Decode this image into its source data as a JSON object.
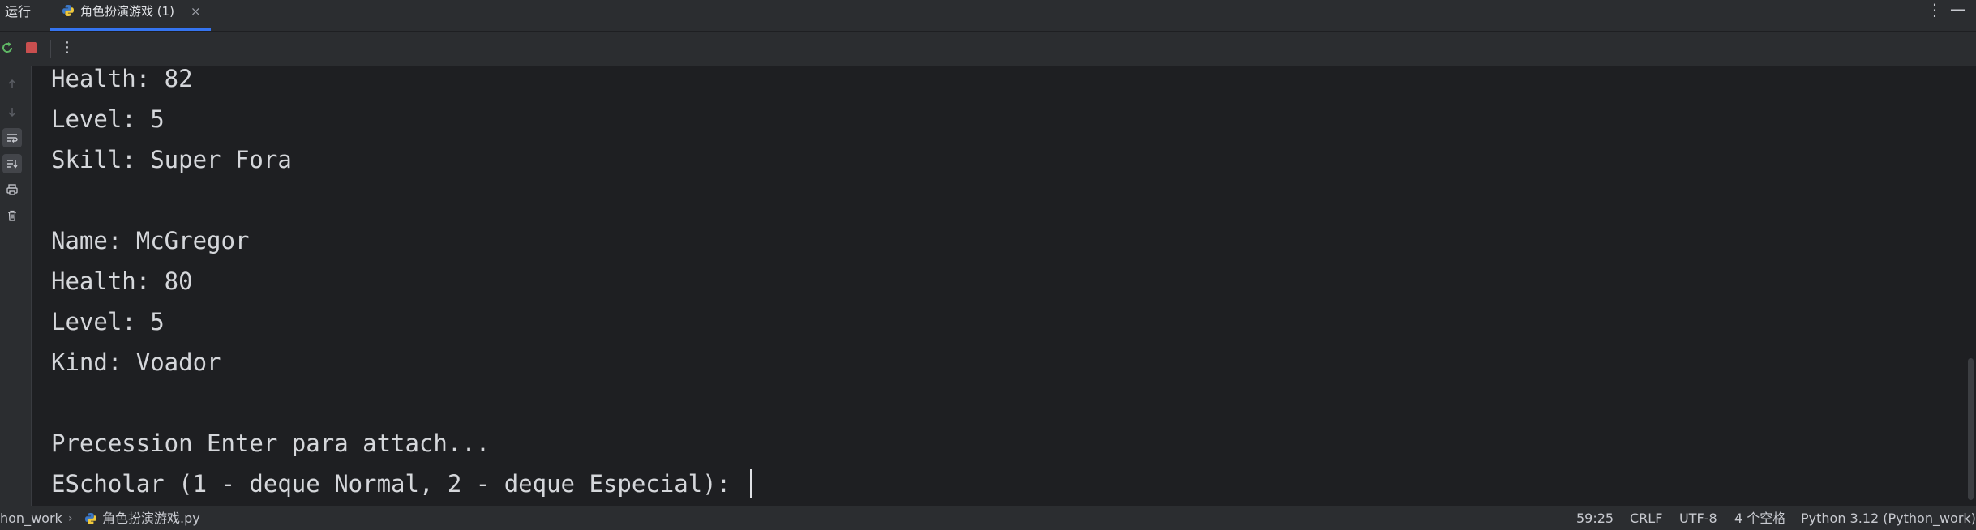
{
  "tool_window": {
    "title": "运行",
    "tab": {
      "label": "角色扮演游戏 (1)",
      "close": "×"
    },
    "more": "⋮",
    "minimize": "—"
  },
  "toolbar": {
    "more": "⋮"
  },
  "gutter": {
    "icons": [
      "arrow-up-icon",
      "arrow-down-icon",
      "soft-wrap-icon",
      "scroll-to-end-icon",
      "print-icon",
      "trash-icon"
    ]
  },
  "console": {
    "lines": [
      "Health: 82",
      "Level: 5",
      "Skill: Super Fora",
      "",
      "Name: McGregor",
      "Health: 80",
      "Level: 5",
      "Kind: Voador",
      "",
      "Precession Enter para attach...",
      "EScholar (1 - deque Normal, 2 - deque Especial): "
    ]
  },
  "statusbar": {
    "project": "hon_work",
    "file": "角色扮演游戏.py",
    "position": "59:25",
    "line_ending": "CRLF",
    "encoding": "UTF-8",
    "indent": "4 个空格",
    "interpreter": "Python 3.12 (Python_work)"
  },
  "colors": {
    "background": "#1e1f22",
    "panel": "#2b2d30",
    "accent": "#3574f0",
    "stop": "#c94f4f"
  }
}
